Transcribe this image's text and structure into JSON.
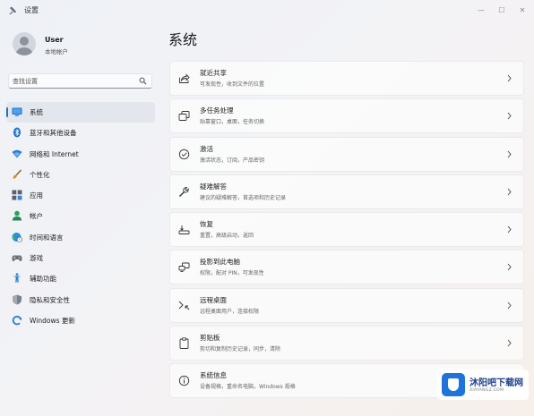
{
  "window": {
    "title": "设置",
    "controls": {
      "minimize": "—",
      "maximize": "☐",
      "close": "✕"
    }
  },
  "user": {
    "name": "User",
    "account_type": "本地帐户"
  },
  "search": {
    "placeholder": "查找设置"
  },
  "sidebar": {
    "items": [
      {
        "label": "系统",
        "icon": "system-display-icon",
        "active": true,
        "color": "#1f6fd0"
      },
      {
        "label": "蓝牙和其他设备",
        "icon": "bluetooth-icon",
        "active": false,
        "color": "#1f6fd0"
      },
      {
        "label": "网络和 Internet",
        "icon": "wifi-icon",
        "active": false,
        "color": "#2b7bd6"
      },
      {
        "label": "个性化",
        "icon": "brush-icon",
        "active": false,
        "color": "#d07a2a"
      },
      {
        "label": "应用",
        "icon": "apps-icon",
        "active": false,
        "color": "#5a6270"
      },
      {
        "label": "帐户",
        "icon": "account-icon",
        "active": false,
        "color": "#2aa160"
      },
      {
        "label": "时间和语言",
        "icon": "globe-clock-icon",
        "active": false,
        "color": "#2a8fd6"
      },
      {
        "label": "游戏",
        "icon": "gamepad-icon",
        "active": false,
        "color": "#6a6f78"
      },
      {
        "label": "辅助功能",
        "icon": "accessibility-icon",
        "active": false,
        "color": "#2a7fd6"
      },
      {
        "label": "隐私和安全性",
        "icon": "shield-icon",
        "active": false,
        "color": "#6a6f78"
      },
      {
        "label": "Windows 更新",
        "icon": "windows-update-icon",
        "active": false,
        "color": "#2a7fd6"
      }
    ]
  },
  "main": {
    "title": "系统",
    "cards": [
      {
        "title": "就近共享",
        "subtitle": "可发现性，收到文件的位置",
        "icon": "nearby-share-icon"
      },
      {
        "title": "多任务处理",
        "subtitle": "贴靠窗口，桌面，任务切换",
        "icon": "multitasking-icon"
      },
      {
        "title": "激活",
        "subtitle": "激活状态，订阅，产品密钥",
        "icon": "activation-check-icon"
      },
      {
        "title": "疑难解答",
        "subtitle": "建议的疑难解答，首选项和历史记录",
        "icon": "wrench-icon"
      },
      {
        "title": "恢复",
        "subtitle": "重置，高级启动，返回",
        "icon": "recovery-icon"
      },
      {
        "title": "投影到此电脑",
        "subtitle": "权限，配对 PIN，可发现性",
        "icon": "project-icon"
      },
      {
        "title": "远程桌面",
        "subtitle": "远程桌面用户，连接权限",
        "icon": "remote-desktop-icon"
      },
      {
        "title": "剪贴板",
        "subtitle": "剪切和复制历史记录，同步，清除",
        "icon": "clipboard-icon"
      },
      {
        "title": "系统信息",
        "subtitle": "设备规格，重命名电脑，Windows 规格",
        "icon": "info-icon"
      }
    ]
  },
  "watermark": {
    "name": "沐阳吧下载网",
    "url": "XIAYANGZ.COM"
  }
}
